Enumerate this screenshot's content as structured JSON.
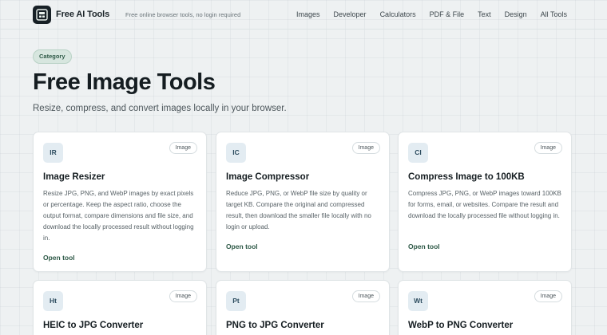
{
  "header": {
    "brand": "Free AI Tools",
    "tagline": "Free online browser tools, no login required",
    "nav": [
      "Images",
      "Developer",
      "Calculators",
      "PDF & File",
      "Text",
      "Design",
      "All Tools"
    ]
  },
  "hero": {
    "category": "Category",
    "title": "Free Image Tools",
    "subtitle": "Resize, compress, and convert images locally in your browser."
  },
  "cards": [
    {
      "abbr": "IR",
      "badge": "Image",
      "title": "Image Resizer",
      "description": "Resize JPG, PNG, and WebP images by exact pixels or percentage. Keep the aspect ratio, choose the output format, compare dimensions and file size, and download the locally processed result without logging in.",
      "link": "Open tool"
    },
    {
      "abbr": "IC",
      "badge": "Image",
      "title": "Image Compressor",
      "description": "Reduce JPG, PNG, or WebP file size by quality or target KB. Compare the original and compressed result, then download the smaller file locally with no login or upload.",
      "link": "Open tool"
    },
    {
      "abbr": "CI",
      "badge": "Image",
      "title": "Compress Image to 100KB",
      "description": "Compress JPG, PNG, or WebP images toward 100KB for forms, email, or websites. Compare the result and download the locally processed file without logging in.",
      "link": "Open tool"
    },
    {
      "abbr": "Ht",
      "badge": "Image",
      "title": "HEIC to JPG Converter"
    },
    {
      "abbr": "Pt",
      "badge": "Image",
      "title": "PNG to JPG Converter"
    },
    {
      "abbr": "Wt",
      "badge": "Image",
      "title": "WebP to PNG Converter"
    }
  ]
}
